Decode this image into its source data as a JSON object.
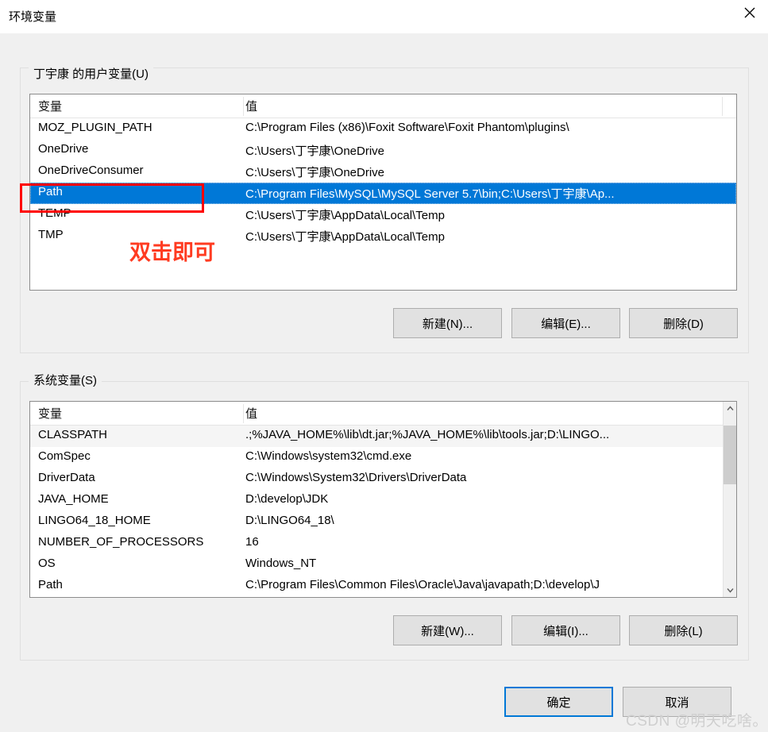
{
  "window": {
    "title": "环境变量",
    "close_icon": "close-icon"
  },
  "user_section": {
    "legend": "丁宇康 的用户变量(U)",
    "columns": [
      "变量",
      "值"
    ],
    "rows": [
      {
        "name": "MOZ_PLUGIN_PATH",
        "value": "C:\\Program Files (x86)\\Foxit Software\\Foxit Phantom\\plugins\\",
        "selected": false
      },
      {
        "name": "OneDrive",
        "value": "C:\\Users\\丁宇康\\OneDrive",
        "selected": false
      },
      {
        "name": "OneDriveConsumer",
        "value": "C:\\Users\\丁宇康\\OneDrive",
        "selected": false
      },
      {
        "name": "Path",
        "value": "C:\\Program Files\\MySQL\\MySQL Server 5.7\\bin;C:\\Users\\丁宇康\\Ap...",
        "selected": true
      },
      {
        "name": "TEMP",
        "value": "C:\\Users\\丁宇康\\AppData\\Local\\Temp",
        "selected": false
      },
      {
        "name": "TMP",
        "value": "C:\\Users\\丁宇康\\AppData\\Local\\Temp",
        "selected": false
      }
    ],
    "buttons": {
      "new": "新建(N)...",
      "edit": "编辑(E)...",
      "delete": "删除(D)"
    }
  },
  "system_section": {
    "legend": "系统变量(S)",
    "columns": [
      "变量",
      "值"
    ],
    "rows": [
      {
        "name": "CLASSPATH",
        "value": ".;%JAVA_HOME%\\lib\\dt.jar;%JAVA_HOME%\\lib\\tools.jar;D:\\LINGO...",
        "alt": true
      },
      {
        "name": "ComSpec",
        "value": "C:\\Windows\\system32\\cmd.exe",
        "alt": false
      },
      {
        "name": "DriverData",
        "value": "C:\\Windows\\System32\\Drivers\\DriverData",
        "alt": false
      },
      {
        "name": "JAVA_HOME",
        "value": "D:\\develop\\JDK",
        "alt": false
      },
      {
        "name": "LINGO64_18_HOME",
        "value": "D:\\LINGO64_18\\",
        "alt": false
      },
      {
        "name": "NUMBER_OF_PROCESSORS",
        "value": "16",
        "alt": false
      },
      {
        "name": "OS",
        "value": "Windows_NT",
        "alt": false
      },
      {
        "name": "Path",
        "value": "C:\\Program Files\\Common Files\\Oracle\\Java\\javapath;D:\\develop\\J",
        "alt": false
      }
    ],
    "buttons": {
      "new": "新建(W)...",
      "edit": "编辑(I)...",
      "delete": "删除(L)"
    },
    "scrollbar": {
      "up_icon": "chevron-up-icon",
      "down_icon": "chevron-down-icon"
    }
  },
  "dialog_buttons": {
    "ok": "确定",
    "cancel": "取消"
  },
  "annotations": {
    "highlight_note": "双击即可",
    "highlight_color": "#FF0000",
    "note_color": "#FF3B21"
  },
  "watermark": {
    "text": "CSDN @明天吃啥。"
  },
  "colors": {
    "selection": "#0078D7",
    "dialog_bg": "#F0F0F0",
    "titlebar_bg": "#FFFFFF",
    "button_bg": "#E1E1E1",
    "accent": "#0078D7"
  }
}
